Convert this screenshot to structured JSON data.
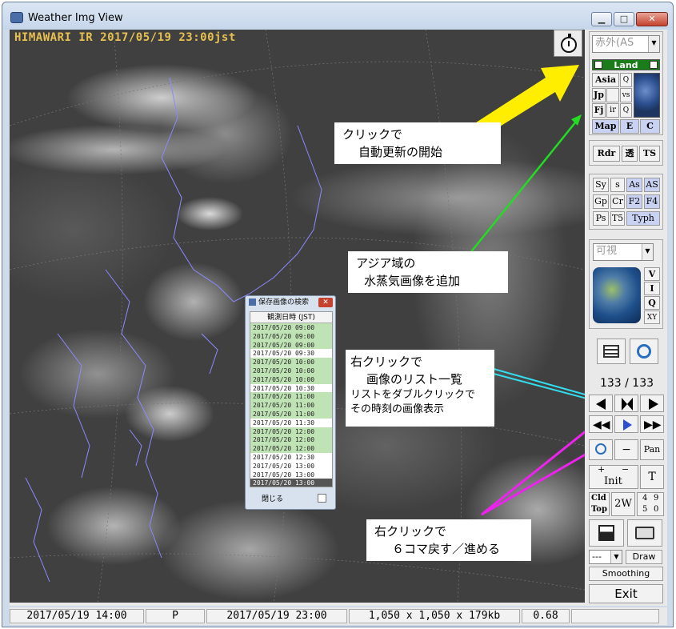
{
  "window": {
    "title": "Weather Img View"
  },
  "image": {
    "caption": "HIMAWARI IR 2017/05/19 23:00jst"
  },
  "annotations": {
    "auto_update_line1": "クリックで",
    "auto_update_line2": "自動更新の開始",
    "wv_line1": "アジア域の",
    "wv_line2": "水蒸気画像を追加",
    "list_line1": "右クリックで",
    "list_line2": "画像のリスト一覧",
    "list_line3": "リストをダブルクリックで",
    "list_line4": "その時刻の画像表示",
    "step_line1": "右クリックで",
    "step_line2": "６コマ戻す／進める"
  },
  "dialog": {
    "title": "保存画像の検索",
    "header": "観測日時 (JST)",
    "rows": [
      {
        "t": "2017/05/20 09:00",
        "green": true
      },
      {
        "t": "2017/05/20 09:00",
        "green": true
      },
      {
        "t": "2017/05/20 09:00",
        "green": true
      },
      {
        "t": "2017/05/20 09:30",
        "green": false
      },
      {
        "t": "2017/05/20 10:00",
        "green": true
      },
      {
        "t": "2017/05/20 10:00",
        "green": true
      },
      {
        "t": "2017/05/20 10:00",
        "green": true
      },
      {
        "t": "2017/05/20 10:30",
        "green": false
      },
      {
        "t": "2017/05/20 11:00",
        "green": true
      },
      {
        "t": "2017/05/20 11:00",
        "green": true
      },
      {
        "t": "2017/05/20 11:00",
        "green": true
      },
      {
        "t": "2017/05/20 11:30",
        "green": false
      },
      {
        "t": "2017/05/20 12:00",
        "green": true
      },
      {
        "t": "2017/05/20 12:00",
        "green": true
      },
      {
        "t": "2017/05/20 12:00",
        "green": true
      },
      {
        "t": "2017/05/20 12:30",
        "green": false
      },
      {
        "t": "2017/05/20 13:00",
        "green": false
      },
      {
        "t": "2017/05/20 13:00",
        "green": false
      },
      {
        "t": "2017/05/20 13:00",
        "green": false,
        "selected": true
      }
    ],
    "close_label": "閉じる"
  },
  "panel": {
    "mode_select": "赤外(AS",
    "land_label": "Land",
    "asia": "Asia",
    "q1": "Q",
    "jp": "Jp",
    "vs": "vs",
    "fj": "Fj",
    "ir": "ir",
    "q2": "Q",
    "map": "Map",
    "e": "E",
    "c": "C",
    "rdr": "Rdr",
    "trans": "透",
    "ts": "TS",
    "sy": "Sy",
    "s": "s",
    "as_lower": "As",
    "as_upper": "AS",
    "gp": "Gp",
    "cr": "Cr",
    "f2": "F2",
    "f4": "F4",
    "ps": "Ps",
    "t5": "T5",
    "typh": "Typh",
    "vis_select": "可視",
    "v": "V",
    "i": "I",
    "q3": "Q",
    "xy": "XY",
    "counter": "133 / 133",
    "minus": "−",
    "pan": "Pan",
    "plus_small": "+",
    "minus_small": "−",
    "init": "Init",
    "t": "T",
    "cld": "Cld",
    "top": "Top",
    "two_w": "2W",
    "n4": "4",
    "n9": "9",
    "n5": "5",
    "n0": "0",
    "draw_select": "---",
    "draw": "Draw",
    "smoothing": "Smoothing",
    "exit": "Exit"
  },
  "status": {
    "left_time": "2017/05/19 14:00",
    "mode": "P",
    "image_time": "2017/05/19 23:00",
    "size": "1,050 x 1,050 x 179kb",
    "zoom": "0.68"
  },
  "colors": {
    "arrow_yellow": "#ffee00",
    "arrow_green": "#22dd22",
    "arrow_cyan": "#33ddee",
    "arrow_magenta": "#ee22ee",
    "land_green": "#1a7d1a"
  }
}
